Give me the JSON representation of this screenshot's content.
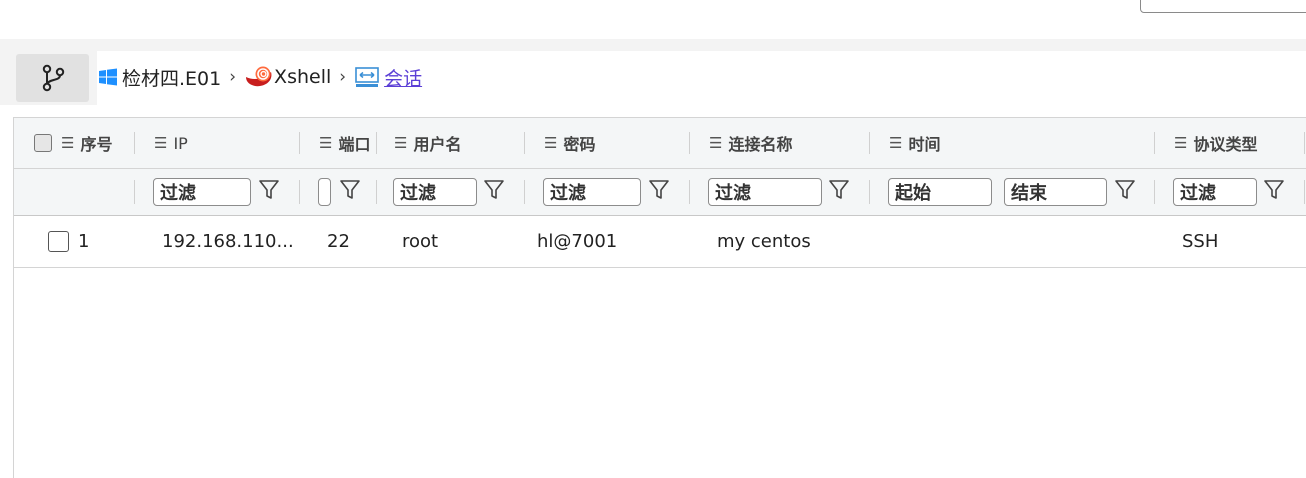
{
  "breadcrumb": {
    "items": [
      {
        "label": "检材四.E01",
        "icon": "windows-icon"
      },
      {
        "label": "Xshell",
        "icon": "xshell-icon"
      },
      {
        "label": "会话",
        "icon": "session-icon"
      }
    ],
    "separator": "›"
  },
  "table": {
    "columns": [
      {
        "key": "index",
        "label": "序号"
      },
      {
        "key": "ip",
        "label": "IP"
      },
      {
        "key": "port",
        "label": "端口"
      },
      {
        "key": "username",
        "label": "用户名"
      },
      {
        "key": "password",
        "label": "密码"
      },
      {
        "key": "connection_name",
        "label": "连接名称"
      },
      {
        "key": "time",
        "label": "时间"
      },
      {
        "key": "protocol",
        "label": "协议类型"
      }
    ],
    "filter": {
      "placeholder": "过滤",
      "start_placeholder": "起始",
      "end_placeholder": "结束"
    },
    "rows": [
      {
        "index": "1",
        "ip": "192.168.110...",
        "port": "22",
        "username": "root",
        "password": "hl@7001",
        "connection_name": "my centos",
        "time": "",
        "protocol": "SSH"
      }
    ]
  },
  "colors": {
    "accent_link": "#5b3fd6",
    "header_bg": "#f4f6f7",
    "crumb_bg": "#f3f3f3"
  }
}
